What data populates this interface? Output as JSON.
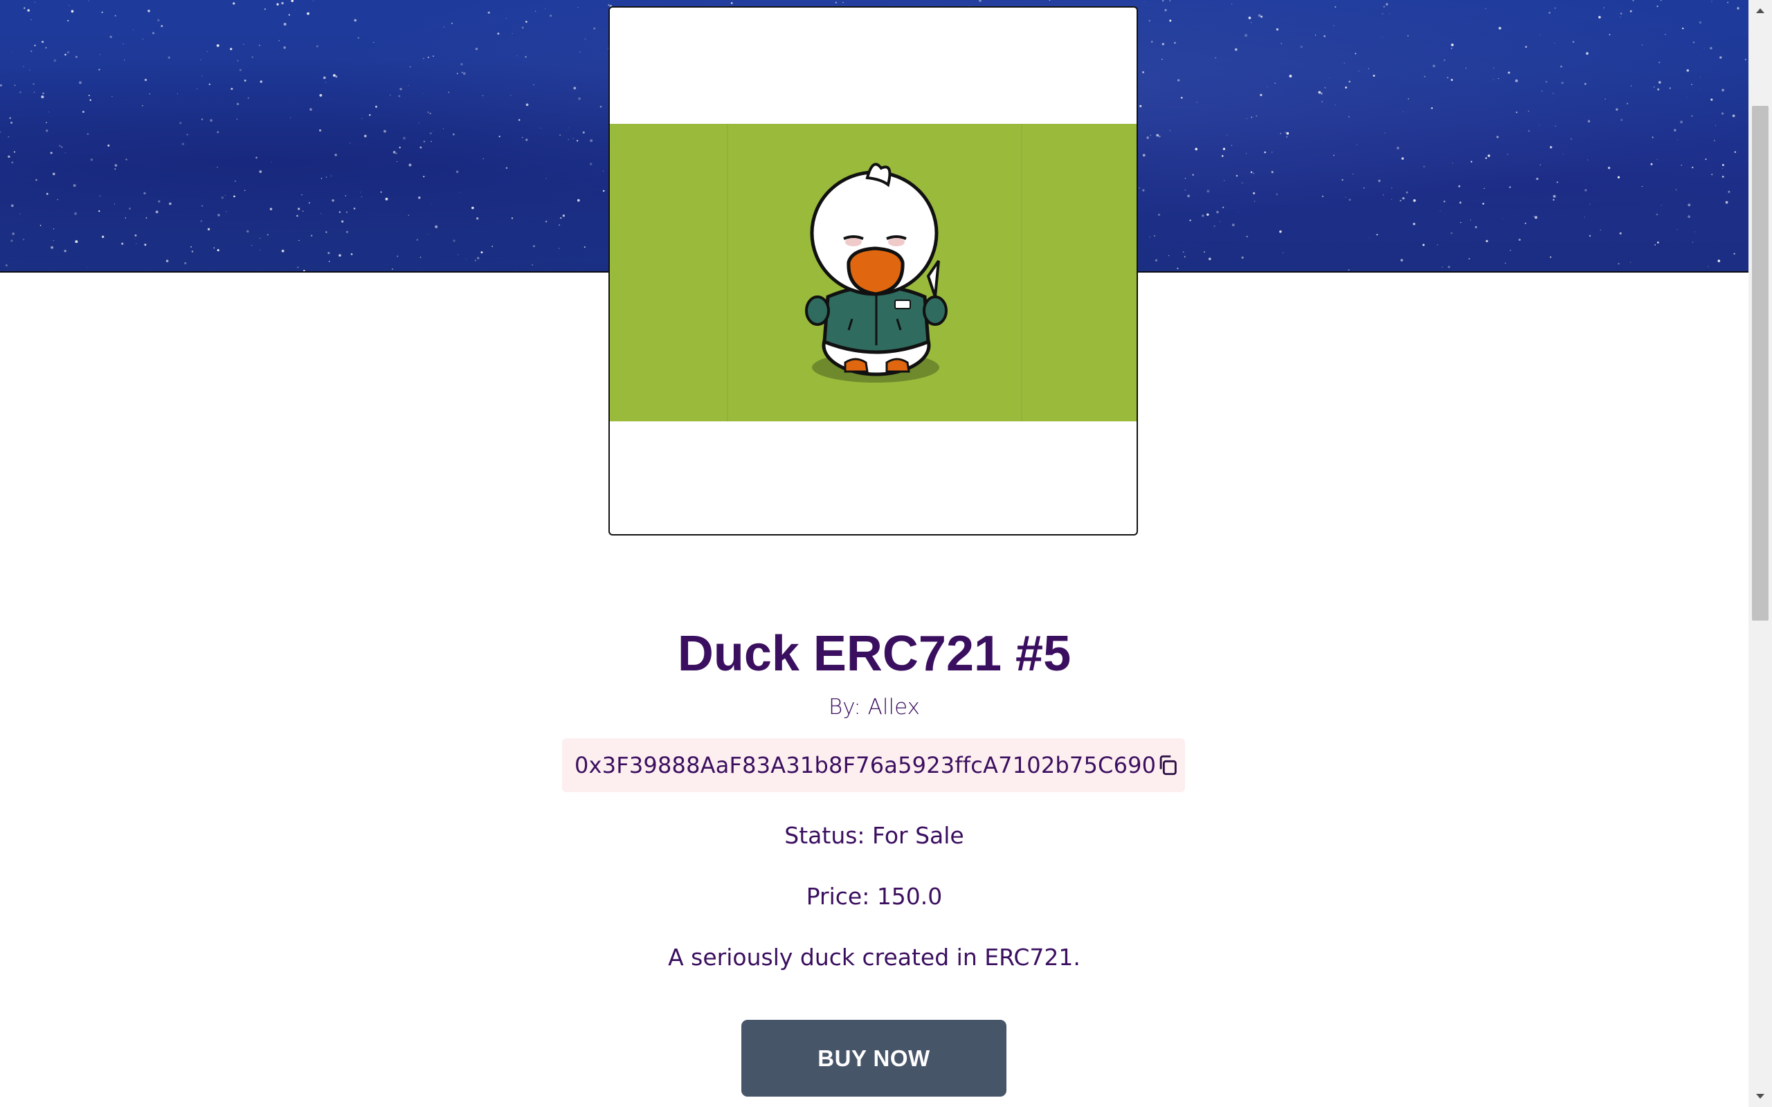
{
  "nft": {
    "title": "Duck ERC721 #5",
    "author_line": "By: Allex",
    "address": "0x3F39888AaF83A31b8F76a5923ffcA7102b75C690",
    "status_line": "Status: For Sale",
    "price_line": "Price: 150.0",
    "description": "A seriously duck created in ERC721.",
    "buy_label": "BUY NOW"
  },
  "icons": {
    "copy": "copy-icon",
    "scroll_up": "scroll-up-arrow-icon",
    "scroll_down": "scroll-down-arrow-icon"
  },
  "colors": {
    "text": "#3b0f5f",
    "button": "#475569",
    "address_bg": "#fdeff0",
    "art_bg": "#9aba3c",
    "banner": "#1e3b9c"
  }
}
